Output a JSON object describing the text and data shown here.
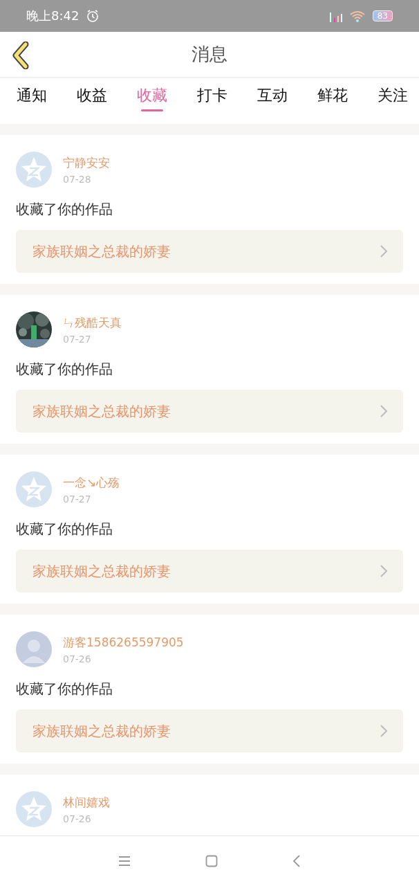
{
  "status_bar": {
    "time": "晚上8:42",
    "battery": "83"
  },
  "header": {
    "title": "消息"
  },
  "tabs": [
    {
      "label": "通知",
      "selected": false
    },
    {
      "label": "收益",
      "selected": false
    },
    {
      "label": "收藏",
      "selected": true
    },
    {
      "label": "打卡",
      "selected": false
    },
    {
      "label": "互动",
      "selected": false
    },
    {
      "label": "鲜花",
      "selected": false
    },
    {
      "label": "关注",
      "selected": false
    }
  ],
  "messages": [
    {
      "user": "宁静安安",
      "date": "07-28",
      "avatar": {
        "kind": "default"
      },
      "action": "收藏了你的作品",
      "work": "家族联姻之总裁的娇妻"
    },
    {
      "user": "ㄣ残酷天真",
      "date": "07-27",
      "action": "收藏了你的作品",
      "work": "家族联姻之总裁的娇妻"
    },
    {
      "user": "一念↘心殇",
      "date": "07-27",
      "avatar": {
        "kind": "default"
      },
      "action": "收藏了你的作品",
      "work": "家族联姻之总裁的娇妻"
    },
    {
      "user": "游客1586265597905",
      "date": "07-26",
      "avatar": {
        "kind": "guest"
      },
      "action": "收藏了你的作品",
      "work": "家族联姻之总裁的娇妻"
    },
    {
      "user": "林间嬉戏",
      "date": "07-26",
      "avatar": {
        "kind": "default"
      }
    }
  ]
}
